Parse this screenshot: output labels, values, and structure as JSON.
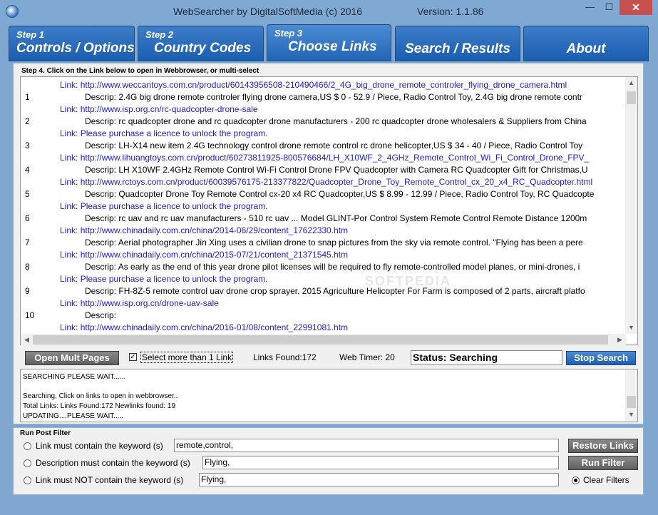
{
  "window": {
    "title": "WebSearcher by DigitalSoftMedia (c) 2016",
    "version": "Version: 1.1.86",
    "minimize": "—",
    "maximize": "☐",
    "close": "✕"
  },
  "tabs": [
    {
      "step": "Step 1",
      "label": "Controls / Options"
    },
    {
      "step": "Step 2",
      "label": "Country Codes"
    },
    {
      "step": "Step 3",
      "label": "Choose Links"
    },
    {
      "step": "",
      "label": "Search / Results"
    },
    {
      "step": "",
      "label": "About"
    }
  ],
  "active_tab": "Choose Links",
  "results": {
    "group_label": "Step 4. Click on the Link below to open in Webbrowser, or multi-select",
    "lines": [
      {
        "num": "",
        "prefix": "Link:",
        "text": "http://www.weccantoys.com.cn/product/60143956508-210490466/2_4G_big_drone_remote_controler_flying_drone_camera.html",
        "kind": "link"
      },
      {
        "num": "1",
        "prefix": "Descrip:",
        "text": "2.4G big drone remote controler flying drone camera,US $ 0 - 52.9 / Piece, Radio Control Toy, 2.4G big drone remote contr",
        "kind": "desc"
      },
      {
        "num": "",
        "prefix": "Link:",
        "text": "http://www.isp.org.cn/rc-quadcopter-drone-sale",
        "kind": "link"
      },
      {
        "num": "2",
        "prefix": "Descrip:",
        "text": "rc quadcopter drone and rc quadcopter drone manufacturers - 200 rc quadcopter drone wholesalers & Suppliers from China",
        "kind": "desc"
      },
      {
        "num": "",
        "prefix": "Link:",
        "text": "Please purchase a licence to unlock the program.",
        "kind": "link"
      },
      {
        "num": "3",
        "prefix": "Descrip:",
        "text": "LH-X14 new item 2.4G technology control drone remote control rc drone helicopter,US $ 34 - 40 / Piece, Radio Control Toy",
        "kind": "desc"
      },
      {
        "num": "",
        "prefix": "Link:",
        "text": "http://www.lihuangtoys.com.cn/product/60273811925-800576684/LH_X10WF_2_4GHz_Remote_Control_Wi_Fi_Control_Drone_FPV_",
        "kind": "link"
      },
      {
        "num": "4",
        "prefix": "Descrip:",
        "text": "LH X10WF 2.4GHz Remote Control Wi-Fi Control Drone FPV Quadcopter with Camera RC Quadcopter Gift for Christmas,U",
        "kind": "desc"
      },
      {
        "num": "",
        "prefix": "Link:",
        "text": "http://www.rctoys.com.cn/product/60039576175-213377822/Quadcopter_Drone_Toy_Remote_Control_cx_20_x4_RC_Quadcopter.html",
        "kind": "link"
      },
      {
        "num": "5",
        "prefix": "Descrip:",
        "text": "Quadcopter Drone Toy Remote Control cx-20 x4 RC Quadcopter,US $ 8.99 - 12.99 / Piece, Radio Control Toy, RC Quadcopte",
        "kind": "desc"
      },
      {
        "num": "",
        "prefix": "Link:",
        "text": "Please purchase a licence to unlock the program.",
        "kind": "link"
      },
      {
        "num": "6",
        "prefix": "Descrip:",
        "text": "rc uav and rc uav manufacturers - 510 rc uav ... Model GLINT-Por Control System Remote Control Remote Distance 1200m",
        "kind": "desc"
      },
      {
        "num": "",
        "prefix": "Link:",
        "text": "http://www.chinadaily.com.cn/china/2014-06/29/content_17622330.htm",
        "kind": "link"
      },
      {
        "num": "7",
        "prefix": "Descrip:",
        "text": "Aerial photographer Jin Xing uses a civilian drone to snap pictures from the sky via remote control. \"Flying has been a pere",
        "kind": "desc"
      },
      {
        "num": "",
        "prefix": "Link:",
        "text": "http://www.chinadaily.com.cn/china/2015-07/21/content_21371545.htm",
        "kind": "link"
      },
      {
        "num": "8",
        "prefix": "Descrip:",
        "text": "As early as the end of this year drone pilot licenses will be required to fly remote-controlled model planes, or mini-drones, i",
        "kind": "desc"
      },
      {
        "num": "",
        "prefix": "Link:",
        "text": "Please purchase a licence to unlock the program.",
        "kind": "link"
      },
      {
        "num": "9",
        "prefix": "Descrip:",
        "text": "FH-8Z-5 remote control uav drone crop sprayer. 2015 Agriculture Helicopter For Farm is composed of 2 parts, aircraft platfo",
        "kind": "desc"
      },
      {
        "num": "",
        "prefix": "Link:",
        "text": "http://www.isp.org.cn/drone-uav-sale",
        "kind": "link"
      },
      {
        "num": "10",
        "prefix": "Descrip:",
        "text": "",
        "kind": "desc"
      },
      {
        "num": "",
        "prefix": "Link:",
        "text": "http://www.chinadaily.com.cn/china/2016-01/08/content_22991081.htm",
        "kind": "link"
      }
    ]
  },
  "controls": {
    "open_mult_pages": "Open Mult Pages",
    "select_more_checkbox_mark": "✓",
    "select_more_label": "Select more than 1 Link",
    "links_found": "Links Found:172",
    "web_timer": "Web Timer: 20",
    "status": "Status: Searching",
    "stop_search": "Stop Search"
  },
  "log": [
    "SEARCHING PLEASE WAIT......",
    "",
    "Searching, Click on links to open in webbrowser..",
    "Total Links: Links Found:172  Newlinks found: 19",
    "UPDATING....PLEASE WAIT....."
  ],
  "filter": {
    "group_label": "Run Post Filter",
    "rows": [
      {
        "label": "Link must contain the keyword (s)",
        "value": "remote,control,"
      },
      {
        "label": "Description must contain the keyword (s)",
        "value": "Flying,"
      },
      {
        "label": "Link must NOT contain the keyword (s)",
        "value": "Flying,"
      }
    ],
    "restore_links": "Restore Links",
    "run_filter": "Run Filter",
    "clear_filters": "Clear Filters"
  }
}
